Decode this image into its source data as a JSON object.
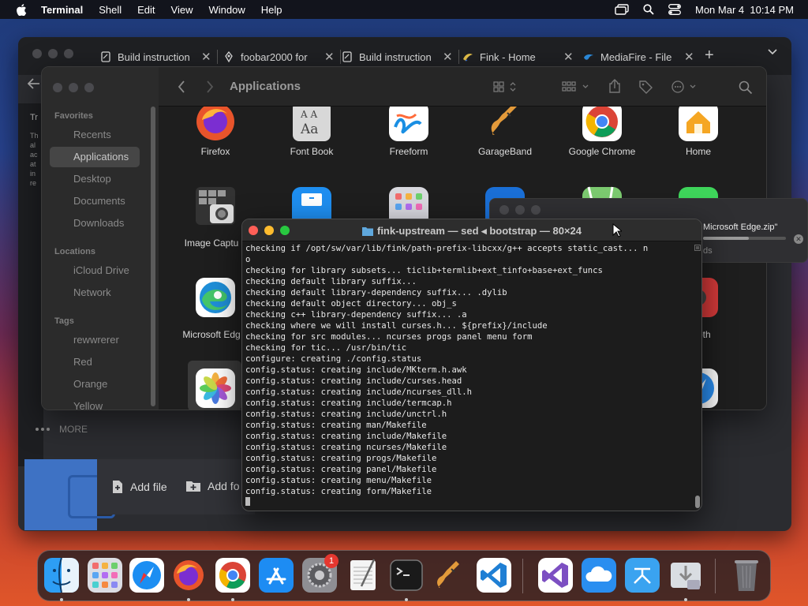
{
  "menubar": {
    "items": [
      "Terminal",
      "Shell",
      "Edit",
      "View",
      "Window",
      "Help"
    ],
    "datetime": "Mon Mar 4  10:14 PM"
  },
  "browser": {
    "tabs": [
      {
        "label": "Build instruction",
        "icon": "document-icon"
      },
      {
        "label": "foobar2000 for",
        "icon": "foobar-icon"
      },
      {
        "label": "Build instruction",
        "icon": "document-icon"
      },
      {
        "label": "Fink - Home",
        "icon": "fink-icon"
      },
      {
        "label": "MediaFire - File",
        "icon": "mediafire-icon"
      }
    ],
    "close_glyph": "✕",
    "new_tab_glyph": "+",
    "side_text": [
      "Tr",
      "Th",
      "al",
      "ac",
      "at",
      "in",
      "re"
    ],
    "more_label": "MORE",
    "add_file": "Add file",
    "add_folder": "Add fo"
  },
  "finder": {
    "title": "Applications",
    "favorites_header": "Favorites",
    "favorites": [
      "Recents",
      "Applications",
      "Desktop",
      "Documents",
      "Downloads"
    ],
    "locations_header": "Locations",
    "locations": [
      "iCloud Drive",
      "Network"
    ],
    "tags_header": "Tags",
    "tags": [
      "rewwrerer",
      "Red",
      "Orange",
      "Yellow"
    ],
    "apps": [
      "Firefox",
      "Font Book",
      "Freeform",
      "GarageBand",
      "Google Chrome",
      "Home",
      "Image Captu",
      "Microsoft Edg",
      "Booth"
    ]
  },
  "download_popup": {
    "filename": "Microsoft Edge.zip\"",
    "status": "ds",
    "progress": 0.55
  },
  "terminal": {
    "title": "fink-upstream — sed ◂ bootstrap — 80×24",
    "lines": [
      "checking if /opt/sw/var/lib/fink/path-prefix-libcxx/g++ accepts static_cast... n",
      "o",
      "checking for library subsets... ticlib+termlib+ext_tinfo+base+ext_funcs",
      "checking default library suffix...",
      "checking default library-dependency suffix... .dylib",
      "checking default object directory... obj_s",
      "checking c++ library-dependency suffix... .a",
      "checking where we will install curses.h... ${prefix}/include",
      "checking for src modules... ncurses progs panel menu form",
      "checking for tic... /usr/bin/tic",
      "configure: creating ./config.status",
      "config.status: creating include/MKterm.h.awk",
      "config.status: creating include/curses.head",
      "config.status: creating include/ncurses_dll.h",
      "config.status: creating include/termcap.h",
      "config.status: creating include/unctrl.h",
      "config.status: creating man/Makefile",
      "config.status: creating include/Makefile",
      "config.status: creating ncurses/Makefile",
      "config.status: creating progs/Makefile",
      "config.status: creating panel/Makefile",
      "config.status: creating menu/Makefile",
      "config.status: creating form/Makefile"
    ]
  },
  "dock": {
    "apps": [
      "Finder",
      "Launchpad",
      "Safari",
      "Firefox",
      "Google Chrome",
      "App Store",
      "System Settings",
      "TextEdit",
      "Terminal",
      "GarageBand",
      "Visual Studio Code",
      "Visual Studio",
      "iCloud",
      "Instruments",
      "Downloads",
      "Trash"
    ],
    "settings_badge": "1"
  }
}
